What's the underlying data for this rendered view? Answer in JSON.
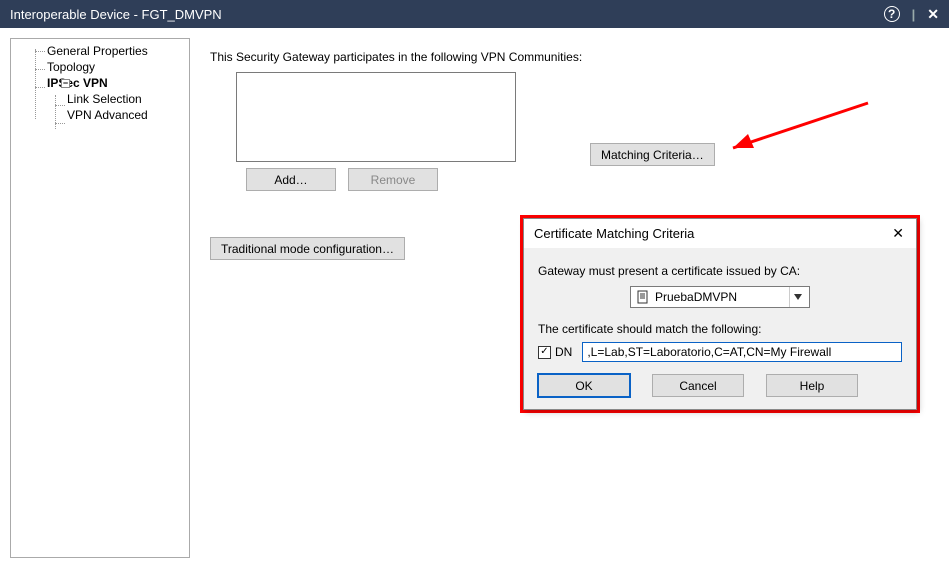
{
  "window": {
    "title": "Interoperable Device - FGT_DMVPN",
    "help_icon": "?",
    "close_icon": "✕"
  },
  "tree": {
    "items": [
      {
        "label": "General Properties"
      },
      {
        "label": "Topology"
      },
      {
        "label": "IPSec VPN",
        "selected": true,
        "children": [
          {
            "label": "Link Selection"
          },
          {
            "label": "VPN Advanced"
          }
        ]
      }
    ],
    "exp_symbol": "−"
  },
  "content": {
    "heading": "This Security Gateway participates in the following VPN Communities:",
    "add_label": "Add…",
    "remove_label": "Remove",
    "matching_label": "Matching Criteria…",
    "traditional_label": "Traditional mode configuration…"
  },
  "dialog": {
    "title": "Certificate Matching Criteria",
    "close_glyph": "✕",
    "line1": "Gateway must present a certificate issued by CA:",
    "ca_value": "PruebaDMVPN",
    "line2": "The certificate should match the following:",
    "dn_label": "DN",
    "dn_checked": true,
    "dn_value": ",L=Lab,ST=Laboratorio,C=AT,CN=My Firewall",
    "ok_label": "OK",
    "cancel_label": "Cancel",
    "help_label": "Help"
  }
}
